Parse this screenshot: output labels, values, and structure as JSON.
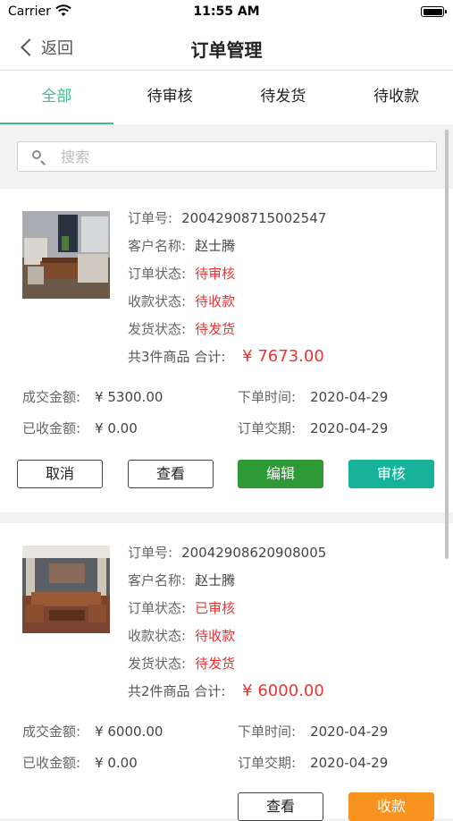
{
  "status_bar": {
    "carrier": "Carrier",
    "time": "11:55 AM"
  },
  "nav": {
    "back_label": "返回",
    "title": "订单管理"
  },
  "tabs": [
    {
      "label": "全部",
      "active": true
    },
    {
      "label": "待审核",
      "active": false
    },
    {
      "label": "待发货",
      "active": false
    },
    {
      "label": "待收款",
      "active": false
    }
  ],
  "search": {
    "placeholder": "搜索",
    "value": ""
  },
  "labels": {
    "order_no": "订单号:",
    "customer": "客户名称:",
    "order_status": "订单状态:",
    "payment_status": "收款状态:",
    "shipping_status": "发货状态:",
    "total": "合计:",
    "deal_amount": "成交金额:",
    "received_amount": "已收金额:",
    "order_time": "下单时间:",
    "delivery_date": "订单交期:"
  },
  "orders": [
    {
      "order_no": "20042908715002547",
      "customer": "赵士腾",
      "order_status": "待审核",
      "payment_status": "待收款",
      "shipping_status": "待发货",
      "items_text": "共3件商品",
      "total": "¥ 7673.00",
      "deal_amount": "¥ 5300.00",
      "received_amount": "¥ 0.00",
      "order_time": "2020-04-29",
      "delivery_date": "2020-04-29",
      "buttons": [
        "取消",
        "查看",
        "编辑",
        "审核"
      ]
    },
    {
      "order_no": "20042908620908005",
      "customer": "赵士腾",
      "order_status": "已审核",
      "payment_status": "待收款",
      "shipping_status": "待发货",
      "items_text": "共2件商品",
      "total": "¥ 6000.00",
      "deal_amount": "¥ 6000.00",
      "received_amount": "¥ 0.00",
      "order_time": "2020-04-29",
      "delivery_date": "2020-04-29",
      "buttons": [
        "查看",
        "收款"
      ]
    }
  ],
  "colors": {
    "accent": "#3dbf8a",
    "red": "#ee3333",
    "green_button": "#2e9a36",
    "teal_button": "#16b39a",
    "orange_button": "#f7931e"
  }
}
